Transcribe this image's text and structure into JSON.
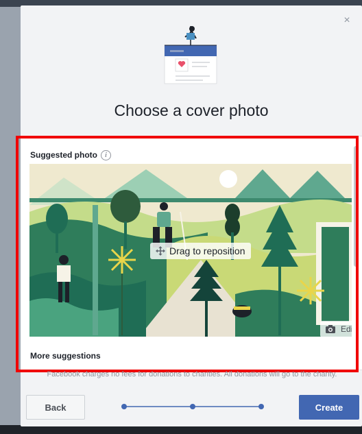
{
  "modal": {
    "title": "Choose a cover photo",
    "close_glyph": "×"
  },
  "panel": {
    "suggested_label": "Suggested photo",
    "info_glyph": "i",
    "drag_text": "Drag to reposition",
    "edit_label": "Edit",
    "more_label": "More suggestions"
  },
  "footer": {
    "fee_note": "Facebook charges no fees for donations to charities. All donations will go to the charity.",
    "back_label": "Back",
    "create_label": "Create",
    "steps_total": 3,
    "current_step": 2
  },
  "colors": {
    "accent": "#4267b2",
    "highlight_border": "#f00000"
  },
  "icons": {
    "close": "close-icon",
    "info": "info-icon",
    "move": "move-icon",
    "camera": "camera-icon"
  }
}
